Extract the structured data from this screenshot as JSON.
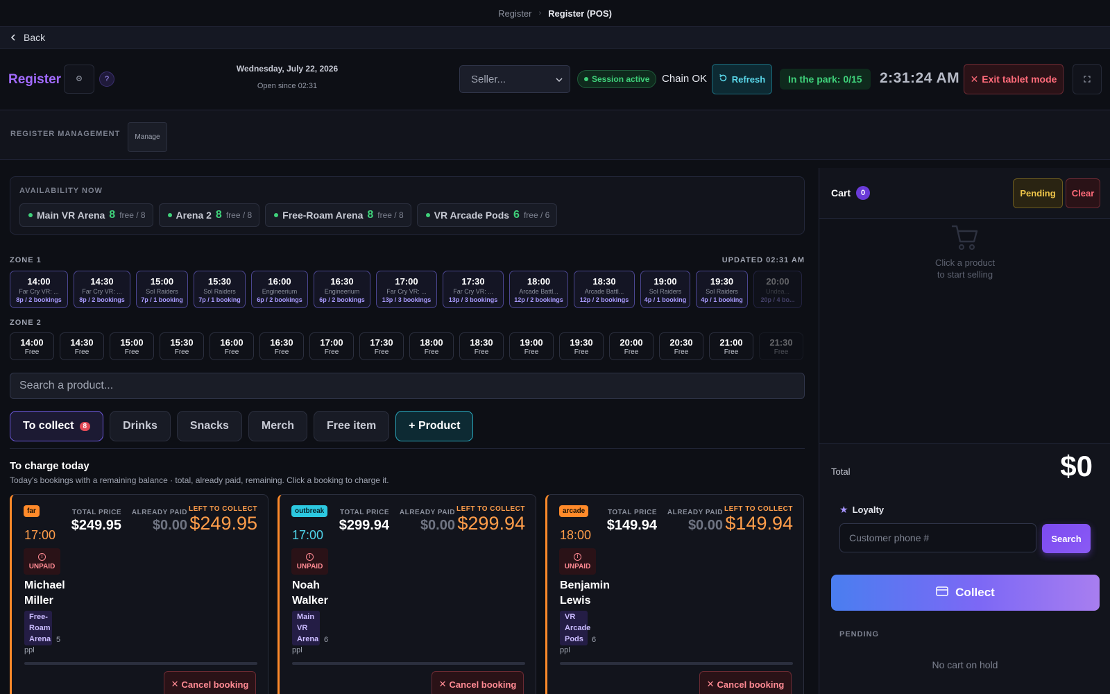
{
  "breadcrumb": {
    "parent": "Register",
    "current": "Register (POS)"
  },
  "back_label": "Back",
  "header": {
    "brand": "Register",
    "date": "Wednesday, July 22, 2026",
    "open_since": "Open since 02:31",
    "seller_placeholder": "Seller...",
    "session_status": "Session active",
    "chain_status": "Chain OK",
    "refresh_label": "Refresh",
    "in_park": "In the park: 0/15",
    "clock": "2:31:24 AM",
    "exit_label": "Exit tablet mode"
  },
  "register_management": {
    "title": "REGISTER MANAGEMENT",
    "manage_label": "Manage"
  },
  "availability": {
    "title": "AVAILABILITY NOW",
    "arenas": [
      {
        "name": "Main VR Arena",
        "free": "8",
        "total": "free / 8"
      },
      {
        "name": "Arena 2",
        "free": "8",
        "total": "free / 8"
      },
      {
        "name": "Free-Roam Arena",
        "free": "8",
        "total": "free / 8"
      },
      {
        "name": "VR Arcade Pods",
        "free": "6",
        "total": "free / 6"
      }
    ]
  },
  "zone1": {
    "label": "ZONE 1",
    "updated": "UPDATED 02:31 AM",
    "slots": [
      {
        "time": "14:00",
        "game": "Far Cry VR: ...",
        "info": "8p / 2 bookings"
      },
      {
        "time": "14:30",
        "game": "Far Cry VR: ...",
        "info": "8p / 2 bookings"
      },
      {
        "time": "15:00",
        "game": "Sol Raiders",
        "info": "7p / 1 booking"
      },
      {
        "time": "15:30",
        "game": "Sol Raiders",
        "info": "7p / 1 booking"
      },
      {
        "time": "16:00",
        "game": "Engineerium",
        "info": "6p / 2 bookings"
      },
      {
        "time": "16:30",
        "game": "Engineerium",
        "info": "6p / 2 bookings"
      },
      {
        "time": "17:00",
        "game": "Far Cry VR: ...",
        "info": "13p / 3 bookings"
      },
      {
        "time": "17:30",
        "game": "Far Cry VR: ...",
        "info": "13p / 3 bookings"
      },
      {
        "time": "18:00",
        "game": "Arcade Battl...",
        "info": "12p / 2 bookings"
      },
      {
        "time": "18:30",
        "game": "Arcade Battl...",
        "info": "12p / 2 bookings"
      },
      {
        "time": "19:00",
        "game": "Sol Raiders",
        "info": "4p / 1 booking"
      },
      {
        "time": "19:30",
        "game": "Sol Raiders",
        "info": "4p / 1 booking"
      },
      {
        "time": "20:00",
        "game": "Undea...",
        "info": "20p / 4 bo..."
      }
    ]
  },
  "zone2": {
    "label": "ZONE 2",
    "slots": [
      {
        "time": "14:00",
        "status": "Free"
      },
      {
        "time": "14:30",
        "status": "Free"
      },
      {
        "time": "15:00",
        "status": "Free"
      },
      {
        "time": "15:30",
        "status": "Free"
      },
      {
        "time": "16:00",
        "status": "Free"
      },
      {
        "time": "16:30",
        "status": "Free"
      },
      {
        "time": "17:00",
        "status": "Free"
      },
      {
        "time": "17:30",
        "status": "Free"
      },
      {
        "time": "18:00",
        "status": "Free"
      },
      {
        "time": "18:30",
        "status": "Free"
      },
      {
        "time": "19:00",
        "status": "Free"
      },
      {
        "time": "19:30",
        "status": "Free"
      },
      {
        "time": "20:00",
        "status": "Free"
      },
      {
        "time": "20:30",
        "status": "Free"
      },
      {
        "time": "21:00",
        "status": "Free"
      },
      {
        "time": "21:30",
        "status": "Free"
      }
    ]
  },
  "product_search_placeholder": "Search a product...",
  "tabs": {
    "to_collect": "To collect",
    "to_collect_count": "8",
    "drinks": "Drinks",
    "snacks": "Snacks",
    "merch": "Merch",
    "free_item": "Free item",
    "add_product": "+ Product"
  },
  "charge": {
    "title": "To charge today",
    "subtitle": "Today's bookings with a remaining balance · total, already paid, remaining. Click a booking to charge it.",
    "headers": {
      "total": "TOTAL PRICE",
      "paid": "ALREADY PAID",
      "left": "LEFT TO COLLECT"
    },
    "unpaid_label": "UNPAID",
    "cancel_label": "Cancel booking",
    "bookings": [
      {
        "tag": "far",
        "time": "17:00",
        "total": "$249.95",
        "paid": "$0.00",
        "left": "$249.95",
        "first": "Michael",
        "last": "Miller",
        "arena": "Free-Roam Arena",
        "people": "5",
        "ppl": "ppl"
      },
      {
        "tag": "outbreak",
        "time": "17:00",
        "total": "$299.94",
        "paid": "$0.00",
        "left": "$299.94",
        "first": "Noah",
        "last": "Walker",
        "arena": "Main VR Arena",
        "people": "6",
        "ppl": "ppl"
      },
      {
        "tag": "arcade",
        "time": "18:00",
        "total": "$149.94",
        "paid": "$0.00",
        "left": "$149.94",
        "first": "Benjamin",
        "last": "Lewis",
        "arena": "VR Arcade Pods",
        "people": "6",
        "ppl": "ppl"
      }
    ]
  },
  "cart": {
    "title": "Cart",
    "count": "0",
    "pending_label": "Pending",
    "clear_label": "Clear",
    "empty_line1": "Click a product",
    "empty_line2": "to start selling",
    "total_label": "Total",
    "total_value": "$0",
    "loyalty_label": "Loyalty",
    "phone_placeholder": "Customer phone #",
    "search_label": "Search",
    "collect_label": "Collect",
    "pending_section": "PENDING",
    "no_hold": "No cart on hold"
  },
  "colors": {
    "accent": "#a26bff",
    "warn": "#ff8a2a",
    "ok": "#3fd17a",
    "danger": "#ff6b7a"
  }
}
